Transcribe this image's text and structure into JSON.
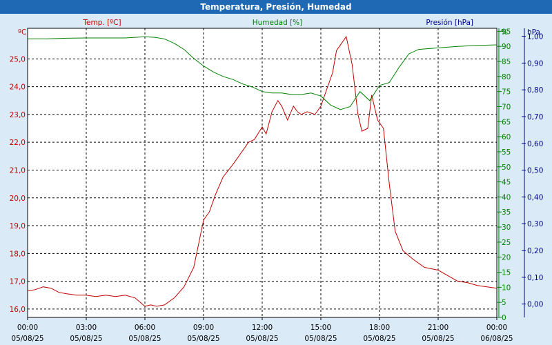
{
  "window": {
    "title": "Temperatura, Presión, Humedad"
  },
  "chart_data": {
    "type": "line",
    "title": "Temperatura, Presión, Humedad",
    "grid": true,
    "colors": {
      "temperature": "#c00000",
      "humidity": "#008000",
      "pressure": "#00008b",
      "background": "#dbeaf7",
      "plot_background": "#ffffff",
      "titlebar": "#1e68b4"
    },
    "axes": {
      "temperature": {
        "label": "Temp. [ºC]",
        "unit": "ºC",
        "ticks": [
          "16,0",
          "17,0",
          "18,0",
          "19,0",
          "20,0",
          "21,0",
          "22,0",
          "23,0",
          "24,0",
          "25,0"
        ],
        "range": [
          15.7,
          26.1
        ]
      },
      "humidity": {
        "label": "Humedad [%]",
        "unit": "%",
        "ticks": [
          "0",
          "5",
          "10",
          "15",
          "20",
          "25",
          "30",
          "35",
          "40",
          "45",
          "50",
          "55",
          "60",
          "65",
          "70",
          "75",
          "80",
          "85",
          "90",
          "95"
        ],
        "range": [
          0,
          96
        ]
      },
      "pressure": {
        "label": "Presión [hPa]",
        "unit": "hPa",
        "ticks": [
          "0,00",
          "0,10",
          "0,20",
          "0,30",
          "0,40",
          "0,50",
          "0,60",
          "0,70",
          "0,80",
          "0,90",
          "1,00"
        ],
        "range": [
          -0.05,
          1.03
        ]
      },
      "x": {
        "ticks": [
          {
            "time": "00:00",
            "date": "05/08/25"
          },
          {
            "time": "03:00",
            "date": "05/08/25"
          },
          {
            "time": "06:00",
            "date": "05/08/25"
          },
          {
            "time": "09:00",
            "date": "05/08/25"
          },
          {
            "time": "12:00",
            "date": "05/08/25"
          },
          {
            "time": "15:00",
            "date": "05/08/25"
          },
          {
            "time": "18:00",
            "date": "05/08/25"
          },
          {
            "time": "21:00",
            "date": "05/08/25"
          },
          {
            "time": "00:00",
            "date": "06/08/25"
          }
        ],
        "range_hours": [
          0,
          24
        ]
      }
    },
    "series": [
      {
        "name": "Temp. [ºC]",
        "axis": "temperature",
        "x_hours": [
          0,
          0.4,
          0.8,
          1.2,
          1.6,
          2,
          2.5,
          3,
          3.5,
          4,
          4.5,
          5,
          5.5,
          6,
          6.3,
          6.6,
          7,
          7.5,
          8,
          8.5,
          9,
          9.3,
          9.6,
          10,
          10.5,
          11,
          11.3,
          11.6,
          12,
          12.2,
          12.5,
          12.8,
          13,
          13.3,
          13.6,
          13.8,
          14,
          14.3,
          14.7,
          15,
          15.3,
          15.6,
          15.8,
          16,
          16.3,
          16.6,
          16.9,
          17.1,
          17.4,
          17.6,
          17.9,
          18.2,
          18.5,
          18.8,
          19.2,
          19.7,
          20.3,
          21,
          21.5,
          22,
          22.5,
          23,
          23.5,
          24
        ],
        "values": [
          16.65,
          16.7,
          16.8,
          16.75,
          16.6,
          16.55,
          16.5,
          16.5,
          16.45,
          16.5,
          16.45,
          16.5,
          16.4,
          16.1,
          16.15,
          16.1,
          16.15,
          16.4,
          16.8,
          17.5,
          19.2,
          19.5,
          20.1,
          20.75,
          21.2,
          21.7,
          22.0,
          22.1,
          22.55,
          22.3,
          23.1,
          23.5,
          23.3,
          22.8,
          23.3,
          23.1,
          23.0,
          23.1,
          23.0,
          23.3,
          23.9,
          24.5,
          25.3,
          25.5,
          25.8,
          24.8,
          23.0,
          22.4,
          22.5,
          23.7,
          22.8,
          22.5,
          20.5,
          18.8,
          18.1,
          17.8,
          17.5,
          17.4,
          17.2,
          17.0,
          16.95,
          16.85,
          16.8,
          16.75
        ]
      },
      {
        "name": "Humedad [%]",
        "axis": "humidity",
        "x_hours": [
          0,
          1,
          2,
          3,
          4,
          5,
          6,
          6.5,
          7,
          7.5,
          8,
          8.5,
          9,
          9.5,
          10,
          10.5,
          11,
          11.5,
          12,
          12.5,
          13,
          13.5,
          14,
          14.5,
          15,
          15.5,
          16,
          16.5,
          17,
          17.5,
          18,
          18.5,
          19,
          19.5,
          20,
          21,
          22,
          23,
          24
        ],
        "values": [
          92.5,
          92.5,
          92.7,
          92.8,
          92.8,
          92.8,
          93.2,
          93.0,
          92.5,
          91,
          89,
          86,
          83.5,
          81.5,
          80,
          79,
          77.5,
          76.5,
          75,
          74.5,
          74.5,
          74,
          74,
          74.5,
          73.5,
          70.5,
          69,
          70,
          75,
          72,
          77,
          78,
          83,
          87.5,
          89,
          89.5,
          90,
          90.3,
          90.5
        ]
      },
      {
        "name": "Presión [hPa]",
        "axis": "pressure",
        "x_hours": [],
        "values": []
      }
    ]
  }
}
